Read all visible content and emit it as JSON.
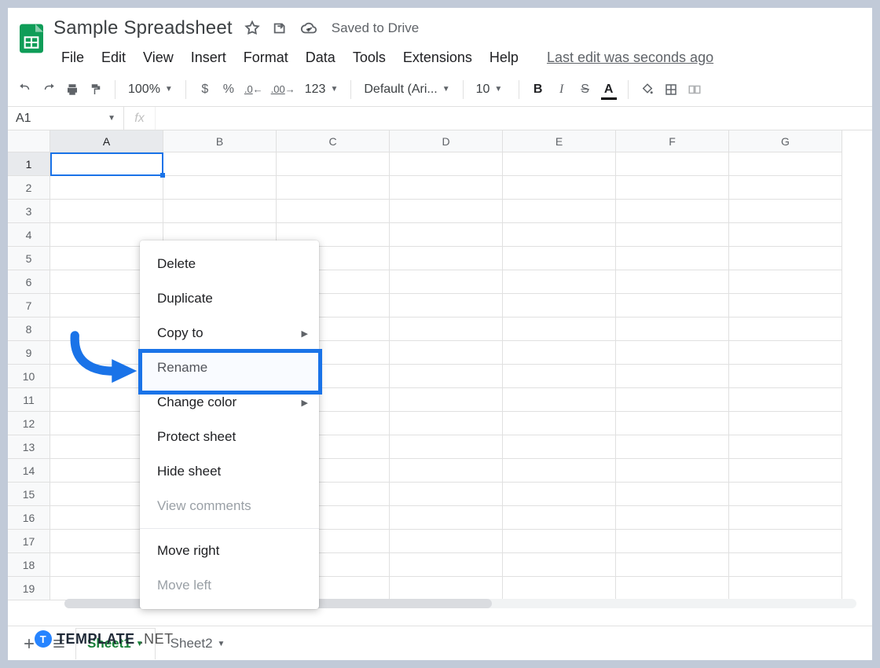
{
  "header": {
    "doc_title": "Sample Spreadsheet",
    "saved_status": "Saved to Drive",
    "menus": [
      "File",
      "Edit",
      "View",
      "Insert",
      "Format",
      "Data",
      "Tools",
      "Extensions",
      "Help"
    ],
    "last_edit": "Last edit was seconds ago"
  },
  "toolbar": {
    "zoom": "100%",
    "font_name": "Default (Ari...",
    "font_size": "10",
    "currency_label": "$",
    "percent_label": "%",
    "dec_dec": ".0",
    "inc_dec": ".00",
    "num_format": "123"
  },
  "namebox": {
    "ref": "A1",
    "fx_symbol": "fx"
  },
  "columns": [
    "A",
    "B",
    "C",
    "D",
    "E",
    "F",
    "G"
  ],
  "rows": [
    1,
    2,
    3,
    4,
    5,
    6,
    7,
    8,
    9,
    10,
    11,
    12,
    13,
    14,
    15,
    16,
    17,
    18,
    19
  ],
  "context_menu": {
    "items": [
      {
        "label": "Delete",
        "type": "item"
      },
      {
        "label": "Duplicate",
        "type": "item"
      },
      {
        "label": "Copy to",
        "type": "submenu"
      },
      {
        "label": "Rename",
        "type": "item",
        "highlighted": true
      },
      {
        "label": "Change color",
        "type": "submenu"
      },
      {
        "label": "Protect sheet",
        "type": "item"
      },
      {
        "label": "Hide sheet",
        "type": "item"
      },
      {
        "label": "View comments",
        "type": "item",
        "disabled": true
      },
      {
        "type": "sep"
      },
      {
        "label": "Move right",
        "type": "item"
      },
      {
        "label": "Move left",
        "type": "item",
        "disabled": true
      }
    ]
  },
  "sheet_tabs": [
    {
      "name": "Sheet1",
      "active": true
    },
    {
      "name": "Sheet2",
      "active": false
    }
  ],
  "watermark": {
    "brand": "TEMPLATE",
    "tld": ".NET"
  },
  "colors": {
    "accent": "#1a73e8",
    "sheets_green": "#188038"
  }
}
